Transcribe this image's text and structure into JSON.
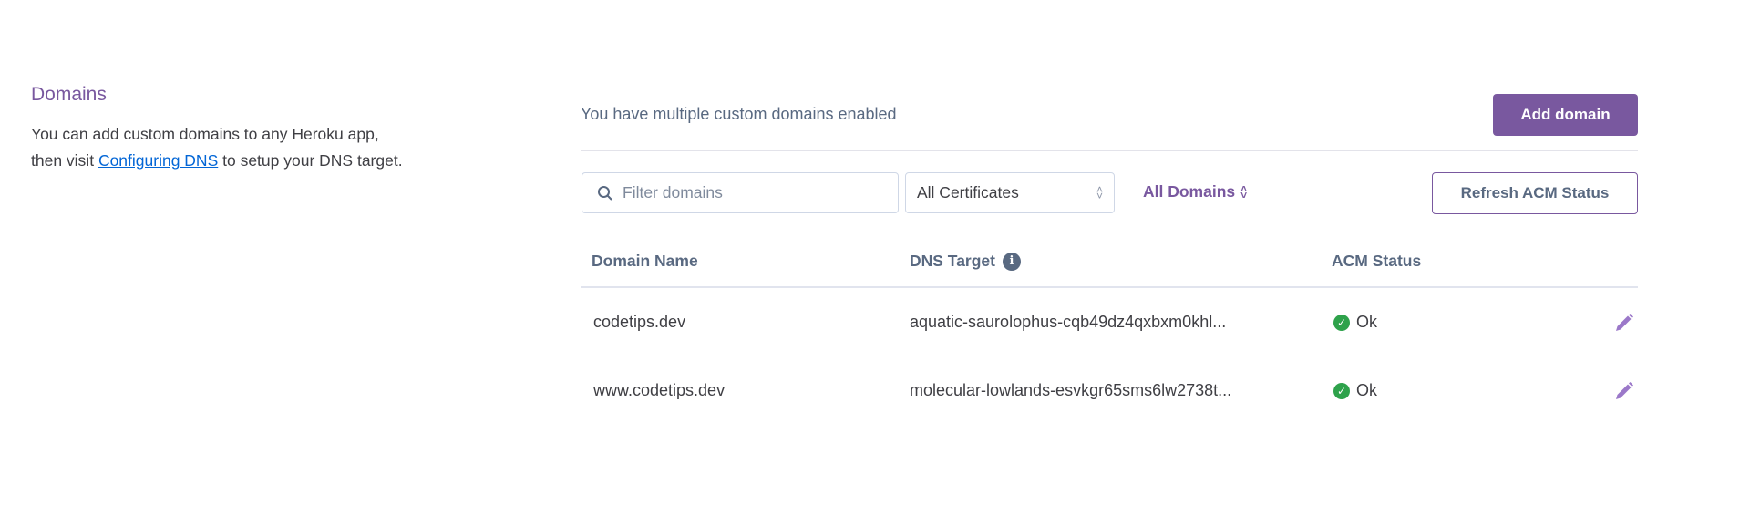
{
  "section": {
    "title": "Domains",
    "description_before": "You can add custom domains to any Heroku app, then visit ",
    "description_link": "Configuring DNS",
    "description_after": " to setup your DNS target."
  },
  "header": {
    "status_text": "You have multiple custom domains enabled",
    "add_domain_label": "Add domain"
  },
  "filters": {
    "search_placeholder": "Filter domains",
    "certificates_selected": "All Certificates",
    "domains_filter": "All Domains",
    "refresh_label": "Refresh ACM Status"
  },
  "table": {
    "columns": [
      "Domain Name",
      "DNS Target",
      "ACM Status"
    ],
    "rows": [
      {
        "domain": "codetips.dev",
        "dns_target": "aquatic-saurolophus-cqb49dz4qxbxm0khl...",
        "acm_status": "Ok"
      },
      {
        "domain": "www.codetips.dev",
        "dns_target": "molecular-lowlands-esvkgr65sms6lw2738t...",
        "acm_status": "Ok"
      }
    ]
  },
  "colors": {
    "accent": "#79589f",
    "success": "#2ea24b",
    "link": "#0366d6"
  }
}
